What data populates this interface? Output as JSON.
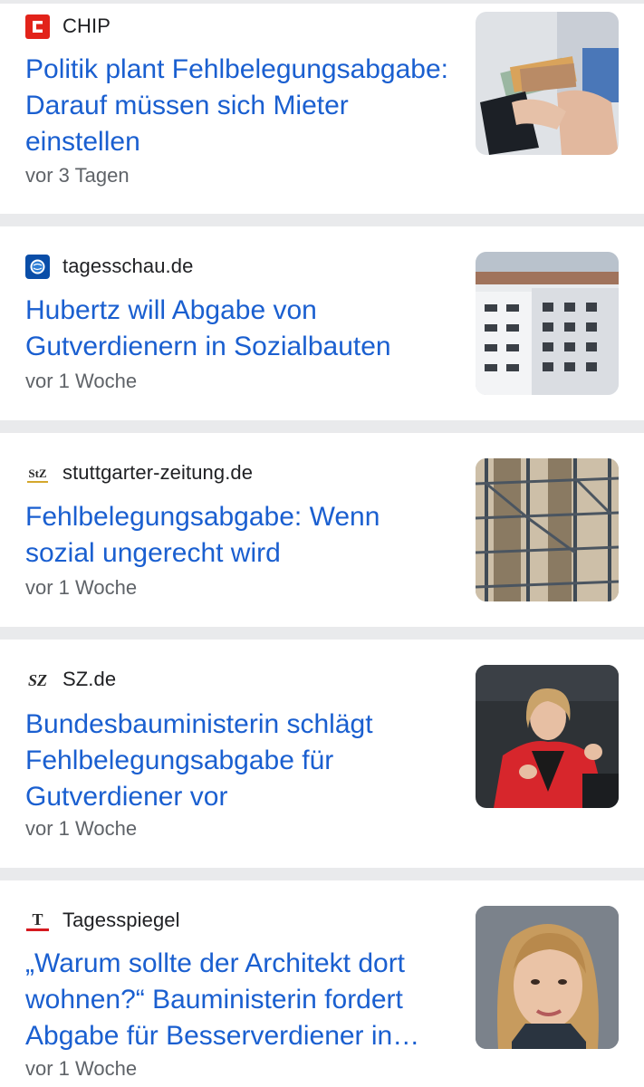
{
  "articles": [
    {
      "source": "CHIP",
      "logo_icon": "chip-logo-icon",
      "headline": "Politik plant Fehlbelegungsabgabe: Darauf müssen sich Mieter einstellen",
      "time": "vor 3 Tagen",
      "thumbnail": "wallet-money-photo"
    },
    {
      "source": "tagesschau.de",
      "logo_icon": "tagesschau-logo-icon",
      "headline": "Hubertz will Abgabe von Gutverdienern in Sozialbauten",
      "time": "vor 1 Woche",
      "thumbnail": "apartment-buildings-photo"
    },
    {
      "source": "stuttgarter-zeitung.de",
      "logo_icon": "stz-logo-icon",
      "logo_text": "StZ",
      "headline": "Fehlbelegungsabgabe: Wenn sozial ungerecht wird",
      "time": "vor 1 Woche",
      "thumbnail": "scaffolding-photo"
    },
    {
      "source": "SZ.de",
      "logo_icon": "sz-logo-icon",
      "logo_text": "SZ",
      "headline": "Bundesbauministerin schlägt Fehlbelegungsabgabe für Gutverdiener vor",
      "time": "vor 1 Woche",
      "thumbnail": "minister-speech-photo"
    },
    {
      "source": "Tagesspiegel",
      "logo_icon": "tagesspiegel-logo-icon",
      "logo_text": "T",
      "headline": "„Warum sollte der Architekt dort wohnen?“ Bauministerin fordert Abgabe für Besserverdiener in…",
      "time": "vor 1 Woche",
      "thumbnail": "minister-portrait-photo"
    }
  ],
  "colors": {
    "headline": "#1a5fd0",
    "source": "#202124",
    "time": "#5f6368",
    "separator": "#e9eaec",
    "chip_red": "#e2231a",
    "tagesschau_blue": "#0a4ea8",
    "tagesspiegel_red": "#d51a20"
  }
}
